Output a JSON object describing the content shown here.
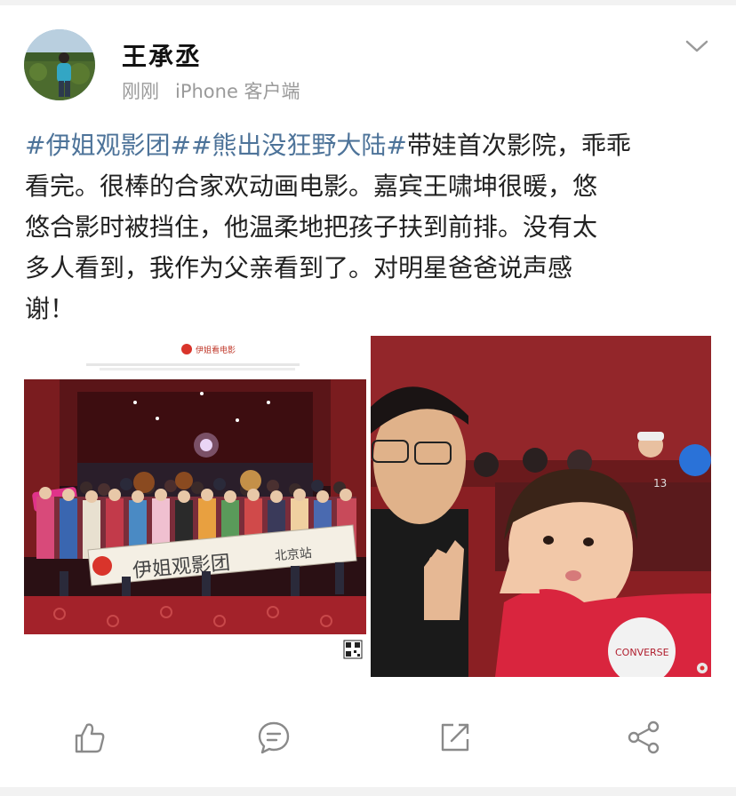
{
  "post": {
    "author": "王承丞",
    "time": "刚刚",
    "source": "iPhone 客户端",
    "text_lines": [
      {
        "hashtag1": "#伊姐观影团#",
        "hashtag2": "#熊出没狂野大陆#",
        "text": "带娃首次影院，乖乖"
      },
      {
        "text": "看完。很棒的合家欢动画电影。嘉宾王啸坤很暖，悠"
      },
      {
        "text": "悠合影时被挡住，他温柔地把孩子扶到前排。没有太"
      },
      {
        "text": "多人看到，我作为父亲看到了。对明星爸爸说声感"
      },
      {
        "text": "谢！"
      }
    ]
  },
  "photo_left": {
    "logo_text": "伊姐看电影",
    "banner_text": "伊姐观影团",
    "banner_subtext": "北京站"
  },
  "photo_right": {
    "shirt_text": "CONVERSE",
    "seat_number": "13"
  },
  "actions": {
    "like_icon": "thumbs-up-icon",
    "comment_icon": "comment-icon",
    "repost_icon": "repost-icon",
    "share_icon": "share-icon"
  },
  "colors": {
    "hashtag": "#4d7399",
    "meta": "#9a9a9a",
    "icon": "#8a8a8a"
  }
}
